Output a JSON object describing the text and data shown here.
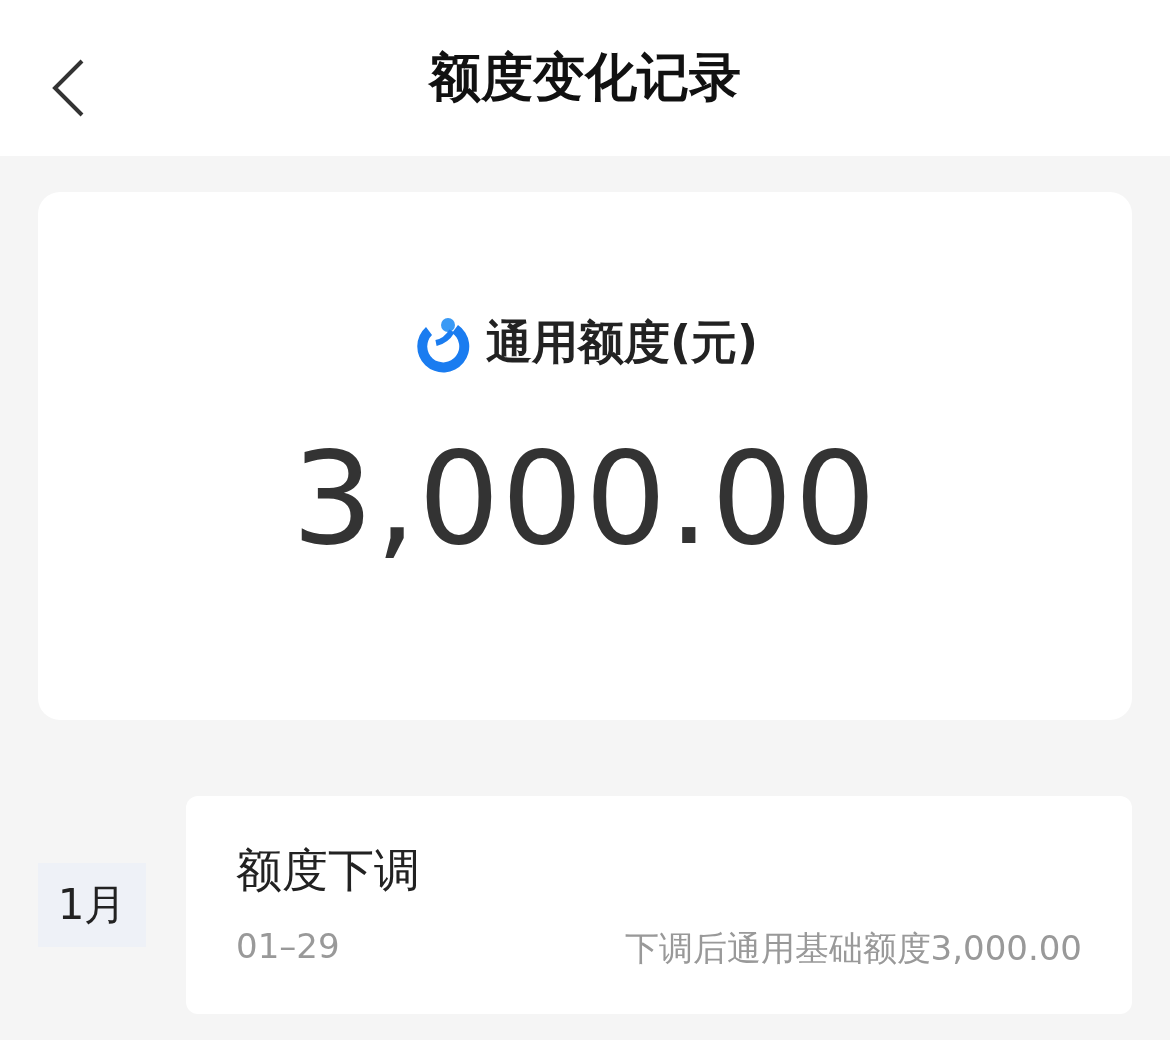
{
  "header": {
    "title": "额度变化记录"
  },
  "summary": {
    "label": "通用额度(元)",
    "amount": "3,000.00"
  },
  "records": [
    {
      "month": "1月",
      "title": "额度下调",
      "date": "01–29",
      "detail": "下调后通用基础额度3,000.00"
    }
  ]
}
